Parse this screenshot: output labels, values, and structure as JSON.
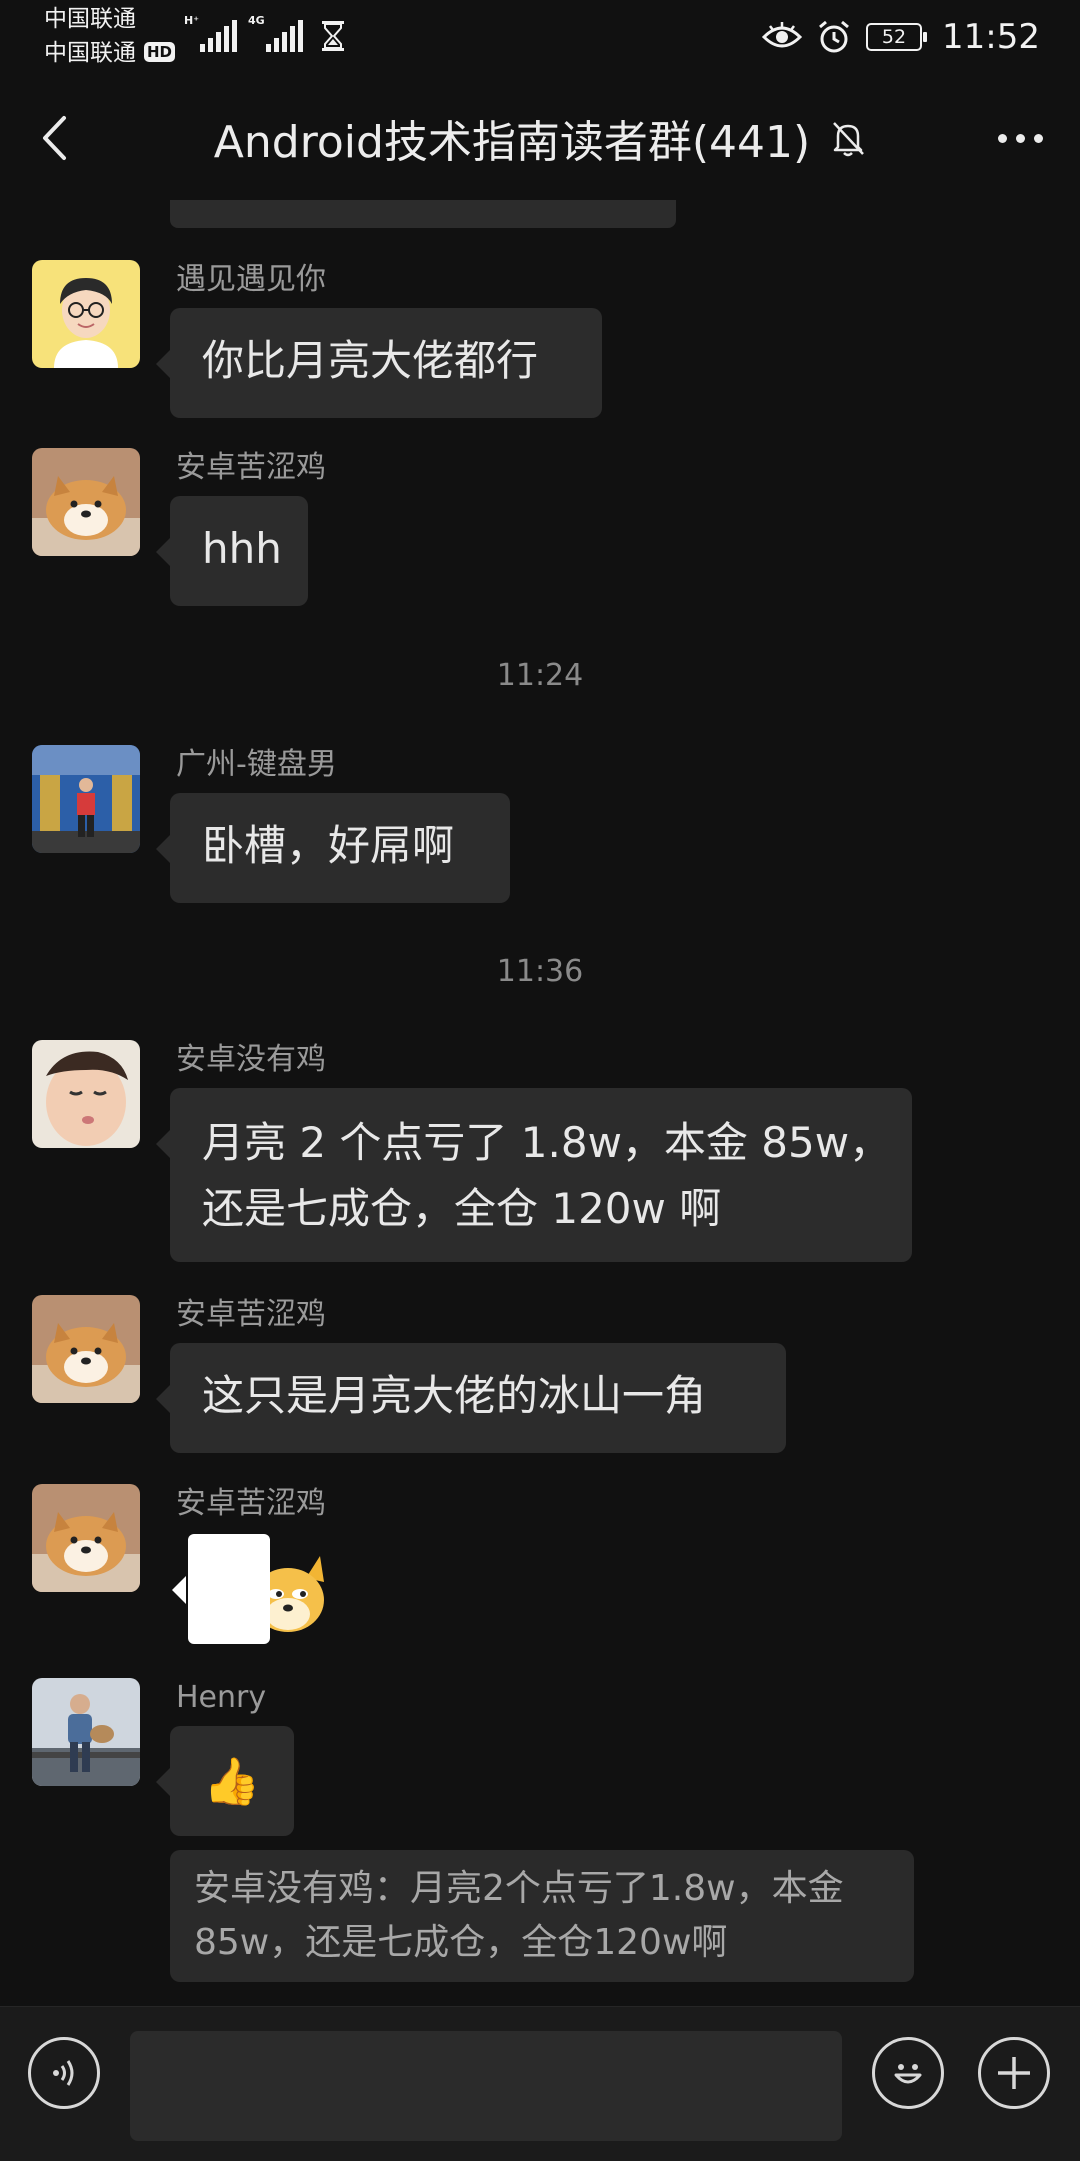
{
  "status_bar": {
    "carrier_1": "中国联通",
    "carrier_2": "中国联通",
    "hd": "HD",
    "signal_1_tag": "H⁺",
    "signal_2_tag": "4G",
    "battery": "52",
    "time": "11:52"
  },
  "header": {
    "title": "Android技术指南读者群(441)",
    "back_icon": "chevron-left-icon",
    "mute_icon": "bell-off-icon",
    "more_icon": "more-dots-icon"
  },
  "messages": [
    {
      "sender": "遇见遇见你",
      "text_lines": [
        "你比月亮大佬都行"
      ]
    },
    {
      "sender": "安卓苦涩鸡",
      "text_lines": [
        "hhh"
      ]
    },
    {
      "sender": "广州-键盘男",
      "text_lines": [
        "卧槽，好屌啊"
      ]
    },
    {
      "sender": "安卓没有鸡",
      "text_lines": [
        "月亮 2 个点亏了 1.8w，本金 85w，",
        "还是七成仓，全仓 120w 啊"
      ]
    },
    {
      "sender": "安卓苦涩鸡",
      "text_lines": [
        "这只是月亮大佬的冰山一角"
      ]
    },
    {
      "sender": "安卓苦涩鸡",
      "text_lines": []
    },
    {
      "sender": "Henry",
      "text_lines": [
        "👍"
      ]
    }
  ],
  "timestamps": [
    "11:24",
    "11:36"
  ],
  "quote": {
    "lines": [
      "安卓没有鸡：月亮2个点亏了1.8w，本金",
      "85w，还是七成仓，全仓120w啊"
    ]
  },
  "input_bar": {
    "voice_icon": "voice-icon",
    "emoji_icon": "emoji-icon",
    "plus_icon": "plus-icon",
    "input_value": ""
  },
  "colors": {
    "background": "#111111",
    "bubble": "#2c2c2c",
    "text": "#e8e8e8",
    "muted": "#9a9a9a"
  }
}
